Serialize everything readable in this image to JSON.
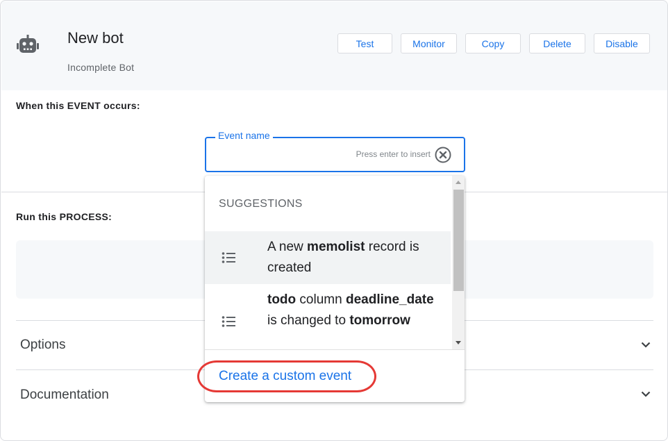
{
  "header": {
    "icon": "robot-icon",
    "title": "New bot",
    "subtitle": "Incomplete Bot",
    "actions": [
      "Test",
      "Monitor",
      "Copy",
      "Delete",
      "Disable"
    ]
  },
  "event_section": {
    "label": "When this EVENT occurs:",
    "field_label": "Event name",
    "value": "",
    "hint": "Press enter to insert",
    "clear_icon": "clear-circle-icon"
  },
  "process_section": {
    "label": "Run this PROCESS:"
  },
  "expanders": [
    {
      "label": "Options",
      "icon": "chevron-down-icon"
    },
    {
      "label": "Documentation",
      "icon": "chevron-down-icon"
    }
  ],
  "dropdown": {
    "heading": "SUGGESTIONS",
    "items": [
      {
        "icon": "list-icon",
        "parts": [
          "A new ",
          "memolist",
          " record is created"
        ]
      },
      {
        "icon": "list-icon",
        "parts": [
          "todo",
          " column ",
          "deadline_date",
          " is changed to ",
          "tomorrow"
        ]
      }
    ],
    "custom_event_link": "Create a custom event"
  },
  "colors": {
    "accent": "#1a73e8",
    "annotation": "#e53935",
    "header_bg": "#f6f8fa"
  }
}
